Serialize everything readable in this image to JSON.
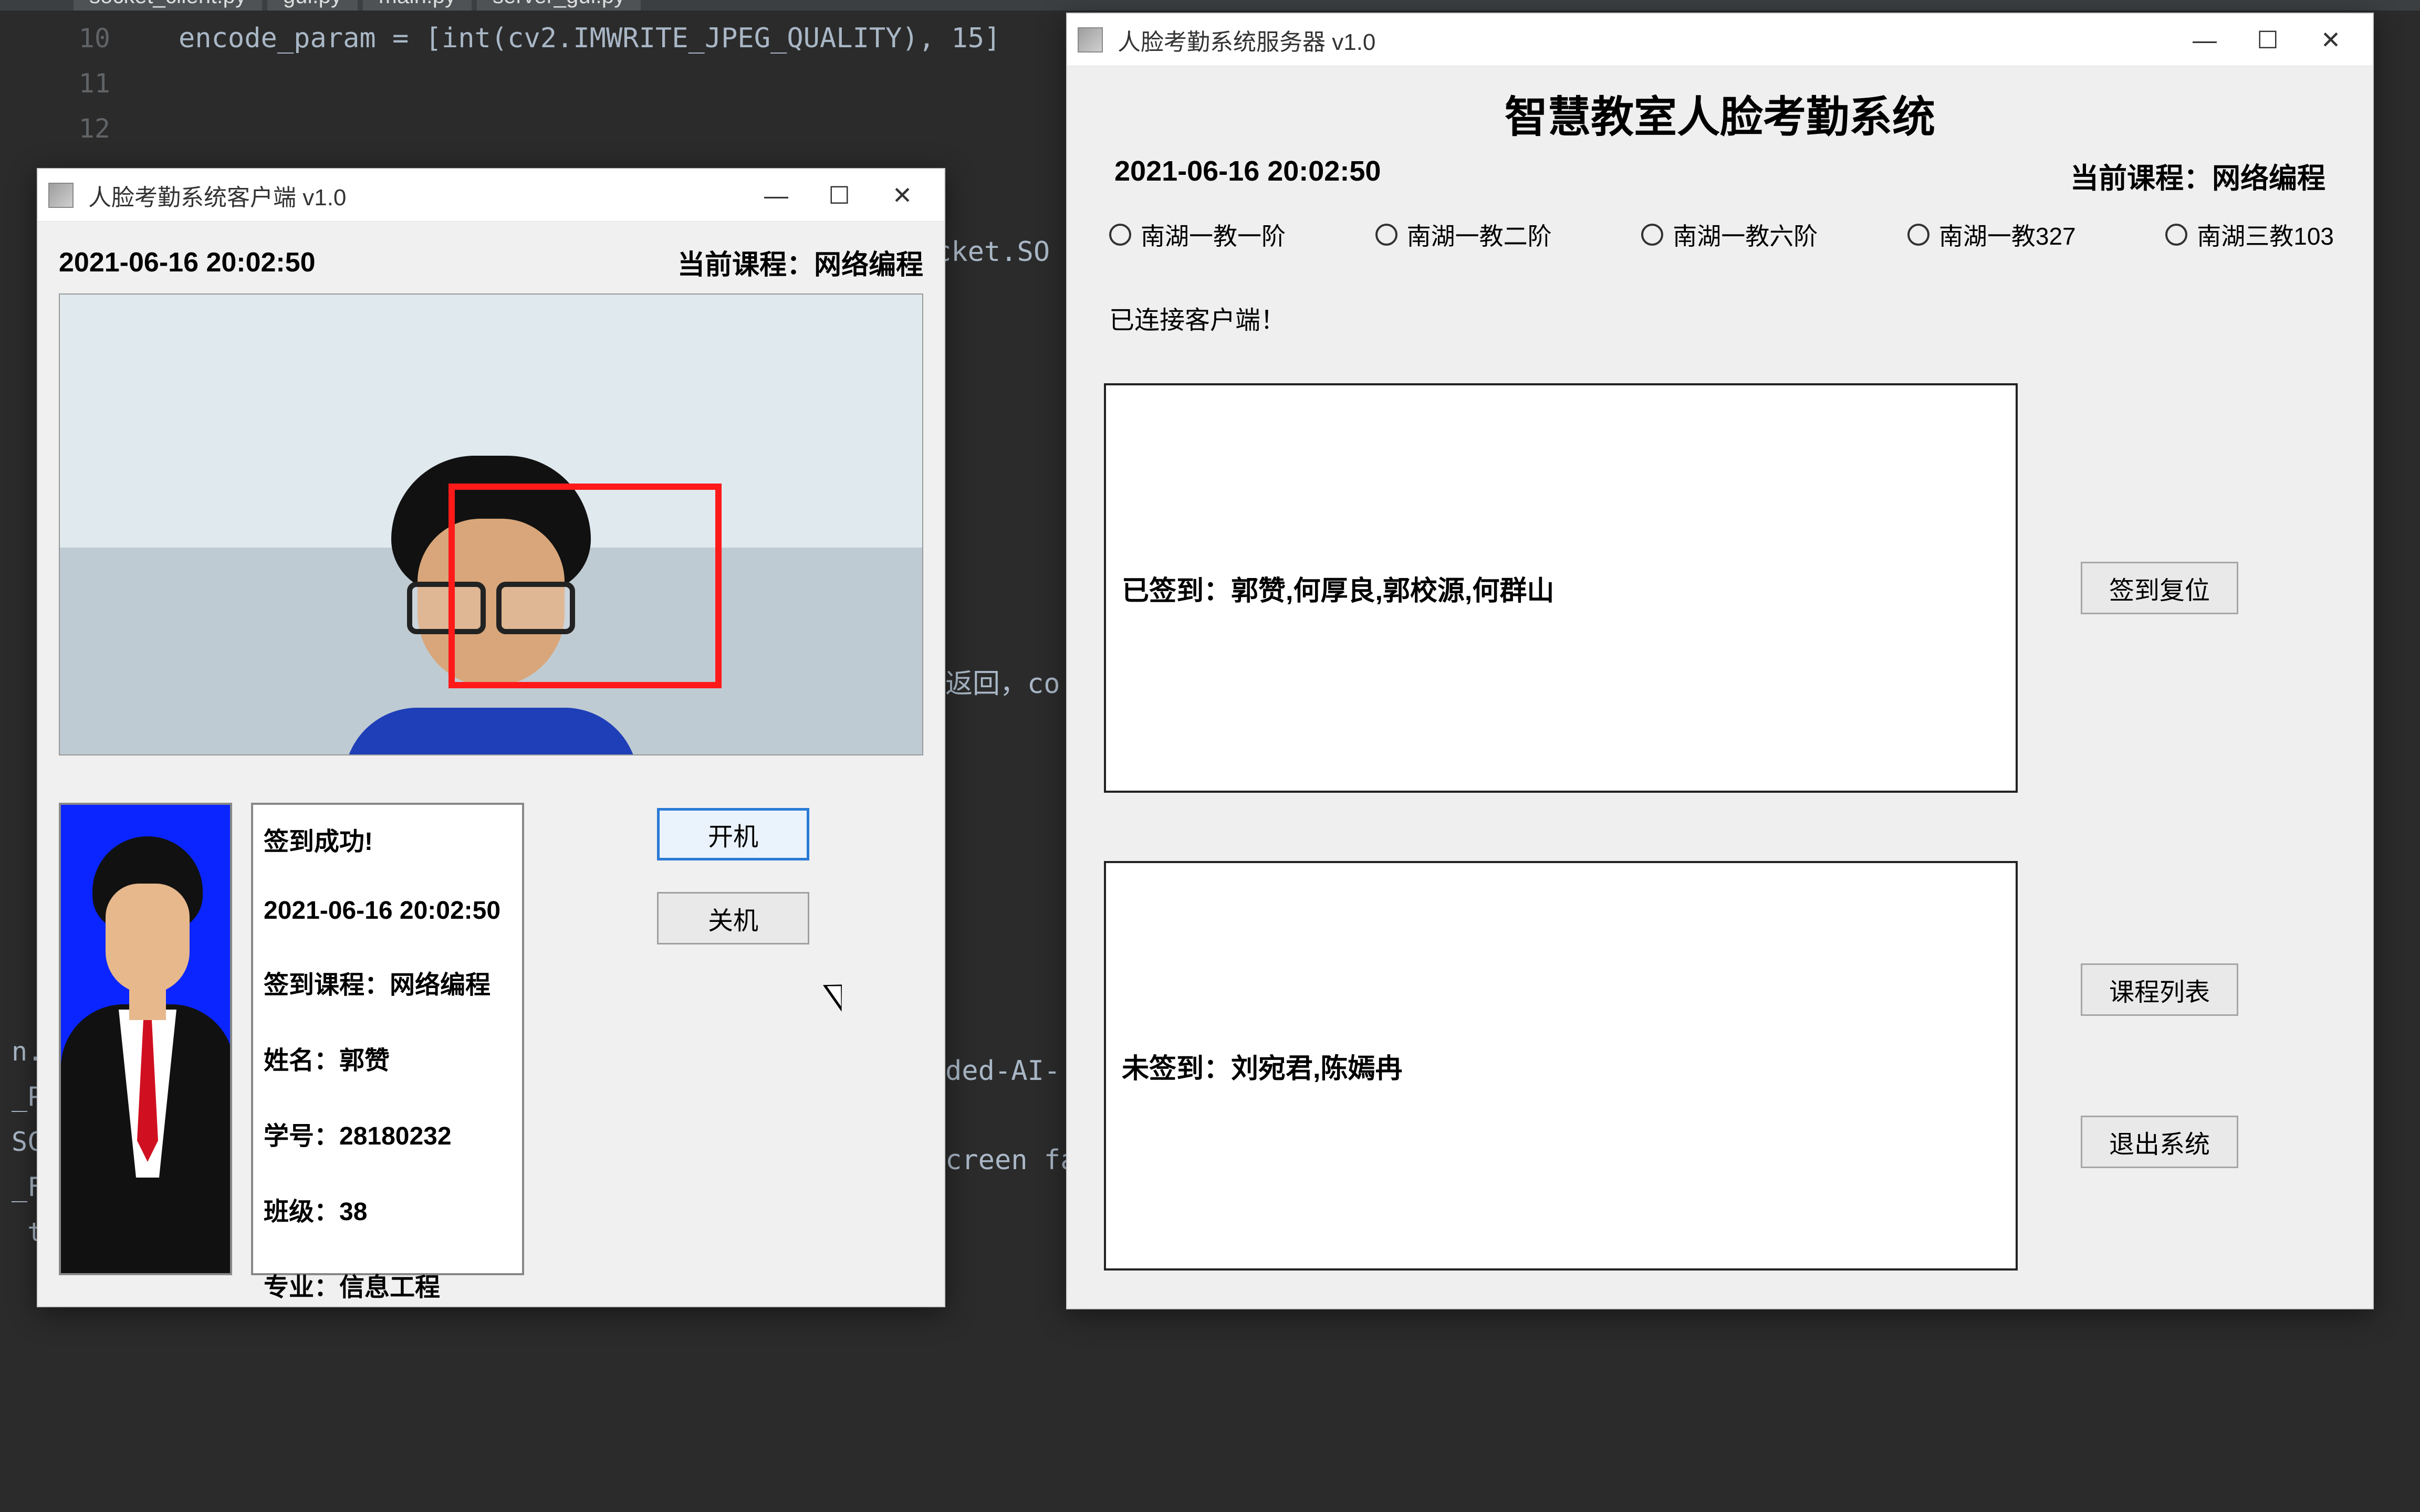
{
  "ide": {
    "tabs": [
      "socket_client.py",
      "gui.py",
      "main.py",
      "server_gui.py"
    ],
    "gutter": [
      "10",
      "11",
      "12"
    ],
    "code_line": "encode_param = [int(cv2.IMWRITE_JPEG_QUALITY), 15]",
    "frag1": "cket.SO",
    "frag2": "返回，co",
    "frag3": "ded-AI-",
    "frag4": "creen fa"
  },
  "client": {
    "title": "人脸考勤系统客户端 v1.0",
    "datetime": "2021-06-16 20:02:50",
    "course_label": "当前课程：网络编程",
    "info": {
      "success": "签到成功!",
      "time": "2021-06-16 20:02:50",
      "course": "签到课程：网络编程",
      "name": "姓名：郭赞",
      "sid": "学号：28180232",
      "class": "班级：38",
      "major": "专业：信息工程"
    },
    "btn_open": "开机",
    "btn_close": "关机"
  },
  "server": {
    "title_bar": "人脸考勤系统服务器 v1.0",
    "heading": "智慧教室人脸考勤系统",
    "datetime": "2021-06-16 20:02:50",
    "course_label": "当前课程：网络编程",
    "radios": [
      "南湖一教一阶",
      "南湖一教二阶",
      "南湖一教六阶",
      "南湖一教327",
      "南湖三教103"
    ],
    "status": "已连接客户端！",
    "signed": "已签到：郭赞,何厚良,郭校源,何群山",
    "unsigned": "未签到：刘宛君,陈嫣冉",
    "btn_reset": "签到复位",
    "btn_courses": "课程列表",
    "btn_exit": "退出系统"
  },
  "term": {
    "l1": "n.e",
    "l2": "_PI",
    "l3": "SCA",
    "l4": "_FA",
    "l5": " to"
  },
  "win": {
    "min": "—",
    "max": "☐",
    "close": "✕"
  }
}
